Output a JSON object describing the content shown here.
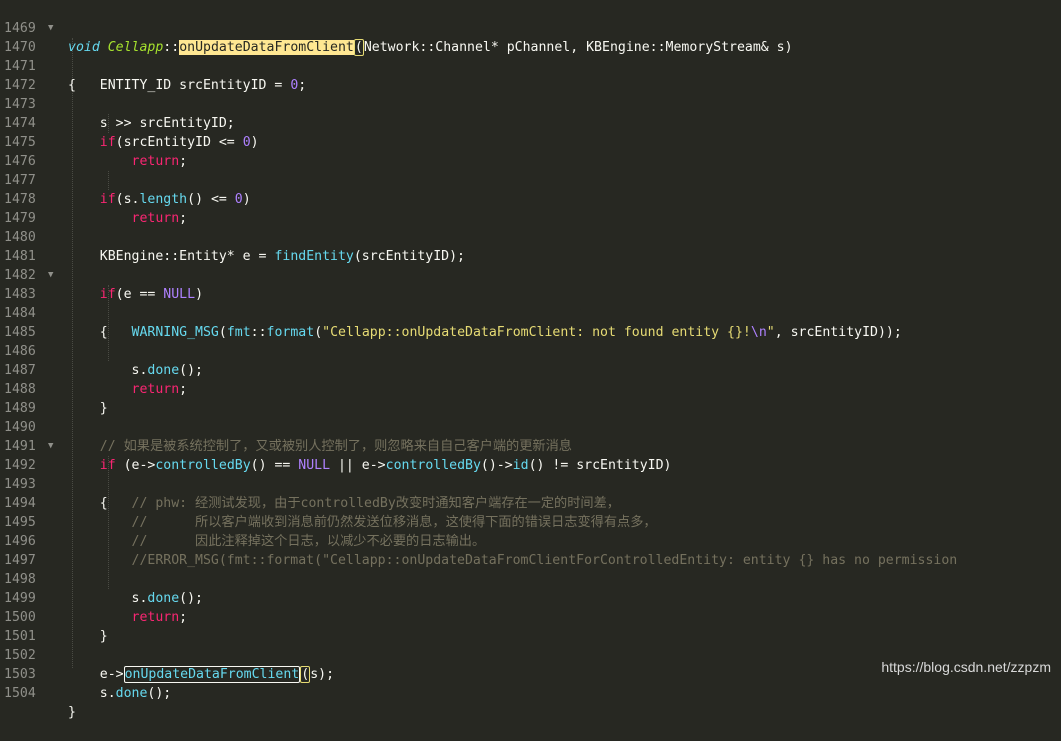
{
  "editor": {
    "lines": [
      {
        "n": "1469",
        "fold": false
      },
      {
        "n": "1470",
        "fold": true
      },
      {
        "n": "1471",
        "fold": false
      },
      {
        "n": "1472",
        "fold": false
      },
      {
        "n": "1473",
        "fold": false
      },
      {
        "n": "1474",
        "fold": false
      },
      {
        "n": "1475",
        "fold": false
      },
      {
        "n": "1476",
        "fold": false
      },
      {
        "n": "1477",
        "fold": false
      },
      {
        "n": "1478",
        "fold": false
      },
      {
        "n": "1479",
        "fold": false
      },
      {
        "n": "1480",
        "fold": false
      },
      {
        "n": "1481",
        "fold": false
      },
      {
        "n": "1482",
        "fold": false
      },
      {
        "n": "1483",
        "fold": true
      },
      {
        "n": "1484",
        "fold": false
      },
      {
        "n": "1485",
        "fold": false
      },
      {
        "n": "1486",
        "fold": false
      },
      {
        "n": "1487",
        "fold": false
      },
      {
        "n": "1488",
        "fold": false
      },
      {
        "n": "1489",
        "fold": false
      },
      {
        "n": "1490",
        "fold": false
      },
      {
        "n": "1491",
        "fold": false
      },
      {
        "n": "1492",
        "fold": true
      },
      {
        "n": "1493",
        "fold": false
      },
      {
        "n": "1494",
        "fold": false
      },
      {
        "n": "1495",
        "fold": false
      },
      {
        "n": "1496",
        "fold": false
      },
      {
        "n": "1497",
        "fold": false
      },
      {
        "n": "1498",
        "fold": false
      },
      {
        "n": "1499",
        "fold": false
      },
      {
        "n": "1500",
        "fold": false
      },
      {
        "n": "1501",
        "fold": false
      },
      {
        "n": "1502",
        "fold": false
      },
      {
        "n": "1503",
        "fold": false
      },
      {
        "n": "1504",
        "fold": false
      }
    ],
    "fold_glyph": "▼",
    "code": {
      "l1469": {
        "t0": "void",
        "t1": " ",
        "t2": "Cellapp",
        "t3": "::",
        "t4": "onUpdateDataFromClient",
        "t5": "(",
        "t6": "Network::Channel* pChannel, KBEngine::MemoryStream& s)"
      },
      "l1470": {
        "t0": "{"
      },
      "l1471": {
        "t0": "    ENTITY_ID srcEntityID = ",
        "t1": "0",
        "t2": ";"
      },
      "l1473": {
        "t0": "    s >> srcEntityID;"
      },
      "l1474": {
        "t0": "    ",
        "t1": "if",
        "t2": "(srcEntityID <= ",
        "t3": "0",
        "t4": ")"
      },
      "l1475": {
        "t0": "        ",
        "t1": "return",
        "t2": ";"
      },
      "l1477": {
        "t0": "    ",
        "t1": "if",
        "t2": "(s.",
        "t3": "length",
        "t4": "() <= ",
        "t5": "0",
        "t6": ")"
      },
      "l1478": {
        "t0": "        ",
        "t1": "return",
        "t2": ";"
      },
      "l1480": {
        "t0": "    KBEngine::Entity* e = ",
        "t1": "findEntity",
        "t2": "(srcEntityID);"
      },
      "l1482": {
        "t0": "    ",
        "t1": "if",
        "t2": "(e == ",
        "t3": "NULL",
        "t4": ")"
      },
      "l1483": {
        "t0": "    {"
      },
      "l1484": {
        "t0": "        ",
        "t1": "WARNING_MSG",
        "t2": "(",
        "t3": "fmt",
        "t4": "::",
        "t5": "format",
        "t6": "(",
        "t7": "\"Cellapp::onUpdateDataFromClient: not found entity {}!",
        "t8": "\\n",
        "t9": "\"",
        "t10": ", srcEntityID));"
      },
      "l1486": {
        "t0": "        s.",
        "t1": "done",
        "t2": "();"
      },
      "l1487": {
        "t0": "        ",
        "t1": "return",
        "t2": ";"
      },
      "l1488": {
        "t0": "    }"
      },
      "l1490": {
        "t0": "    // 如果是被系统控制了，又或被别人控制了，则忽略来自自己客户端的更新消息"
      },
      "l1491": {
        "t0": "    ",
        "t1": "if",
        "t2": " (e->",
        "t3": "controlledBy",
        "t4": "() == ",
        "t5": "NULL",
        "t6": " || e->",
        "t7": "controlledBy",
        "t8": "()->",
        "t9": "id",
        "t10": "() != srcEntityID)"
      },
      "l1492": {
        "t0": "    {"
      },
      "l1493": {
        "t0": "        // phw: 经测试发现，由于controlledBy改变时通知客户端存在一定的时间差，"
      },
      "l1494": {
        "t0": "        //      所以客户端收到消息前仍然发送位移消息，这使得下面的错误日志变得有点多，"
      },
      "l1495": {
        "t0": "        //      因此注释掉这个日志，以减少不必要的日志输出。"
      },
      "l1496": {
        "t0": "        //ERROR_MSG(fmt::format(\"Cellapp::onUpdateDataFromClientForControlledEntity: entity {} has no permission"
      },
      "l1498": {
        "t0": "        s.",
        "t1": "done",
        "t2": "();"
      },
      "l1499": {
        "t0": "        ",
        "t1": "return",
        "t2": ";"
      },
      "l1500": {
        "t0": "    }"
      },
      "l1502": {
        "t0": "    e->",
        "t1": "onUpdateDataFromClient",
        "t2": "(",
        "t3": "s);"
      },
      "l1503": {
        "t0": "    s.",
        "t1": "done",
        "t2": "();"
      },
      "l1504": {
        "t0": "}"
      }
    }
  },
  "watermark": "https://blog.csdn.net/zzpzm",
  "colors": {
    "background": "#272822",
    "keyword": "#f92672",
    "type": "#66d9ef",
    "class": "#a6e22e",
    "number": "#ae81ff",
    "string": "#e6db74",
    "comment": "#75715e",
    "highlight": "#ffe792",
    "line_number": "#90908a"
  }
}
